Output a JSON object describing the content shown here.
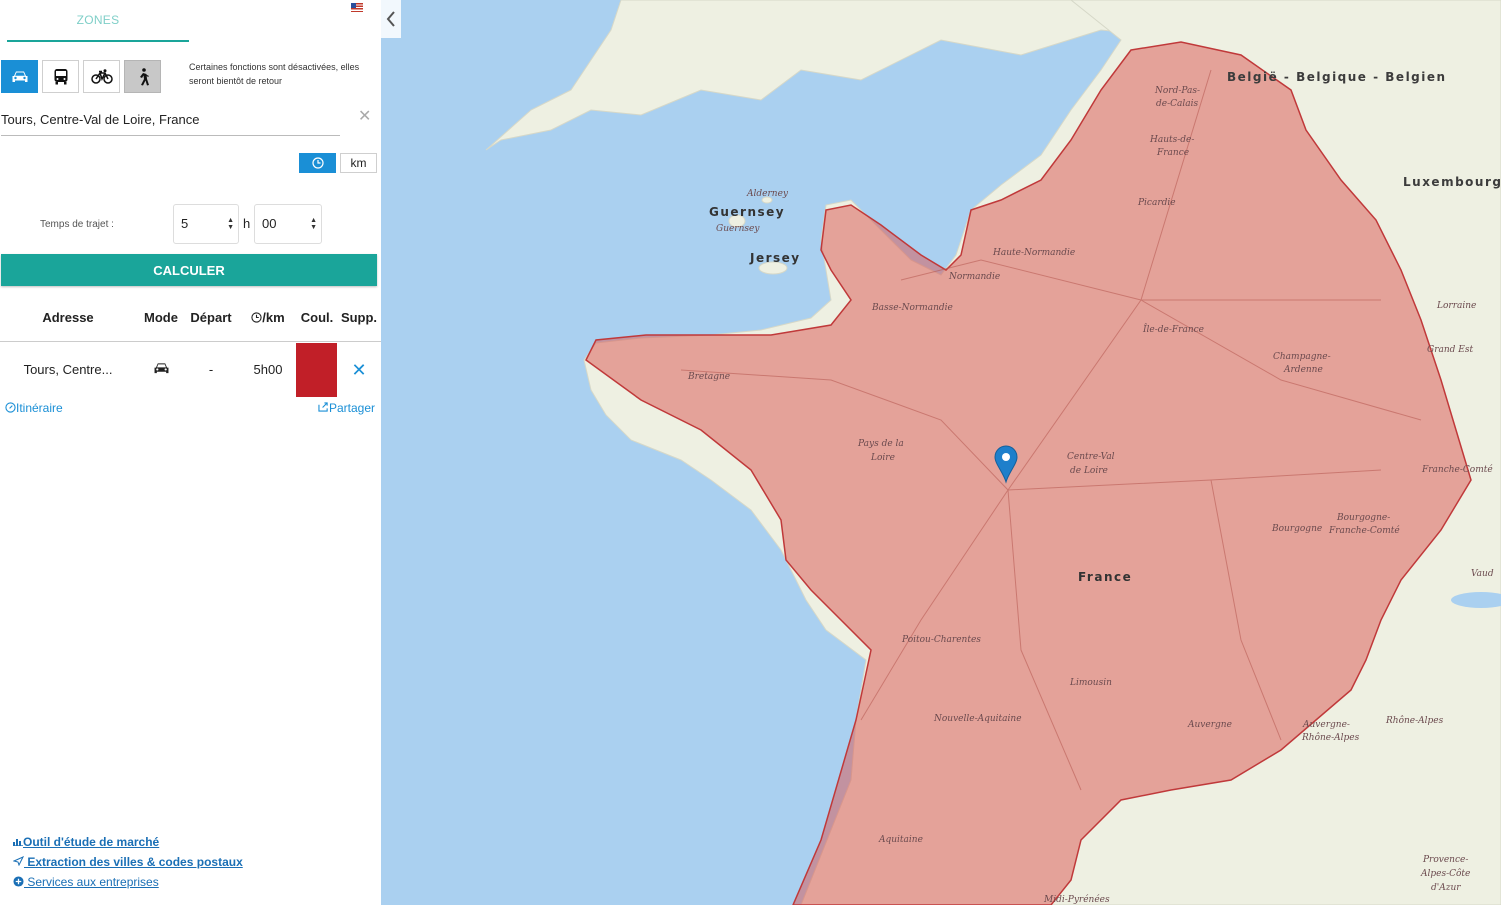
{
  "panel": {
    "tab_label": "ZONES",
    "language_flag": "flag-us",
    "mode_note": "Certaines fonctions sont désactivées, elles seront bientôt de retour",
    "modes": [
      "car-icon",
      "bus-icon",
      "bike-icon",
      "walk-icon"
    ],
    "address_value": "Tours, Centre-Val de Loire, France",
    "unit_km_label": "km",
    "time_label": "Temps de trajet :",
    "hours_value": "5",
    "hours_unit": "h",
    "minutes_value": "00",
    "calc_label": "CALCULER",
    "table": {
      "headers": {
        "address": "Adresse",
        "mode": "Mode",
        "departure": "Départ",
        "timekm": "/km",
        "color": "Coul.",
        "delete": "Supp."
      },
      "row": {
        "address": "Tours, Centre...",
        "mode": "car-icon",
        "departure": "-",
        "time": "5h00",
        "color": "#c11f28",
        "delete": "✕"
      }
    },
    "itinerary_label": "Itinéraire",
    "share_label": "Partager",
    "footer": {
      "market_study": "Outil d'étude de marché",
      "extraction": " Extraction des villes & codes postaux",
      "services": " Services aux entreprises"
    }
  },
  "map": {
    "zone_fill": "#d9534f",
    "labels": {
      "belgium": "België - Belgique - Belgien",
      "luxembourg": "Luxembourg",
      "guernsey": "Guernsey",
      "guernsey_small": "Guernsey",
      "alderney": "Alderney",
      "jersey": "Jersey",
      "france": "France",
      "npdc1": "Nord-Pas-",
      "npdc2": "de-Calais",
      "hdf1": "Hauts-de-",
      "hdf2": "France",
      "picardie": "Picardie",
      "haute_normandie": "Haute-Normandie",
      "normandie": "Normandie",
      "basse_normandie": "Basse-Normandie",
      "idf": "Île-de-France",
      "champagne1": "Champagne-",
      "champagne2": "Ardenne",
      "lorraine": "Lorraine",
      "grand_est": "Grand Est",
      "bretagne": "Bretagne",
      "pdl1": "Pays de la",
      "pdl2": "Loire",
      "cvl1": "Centre-Val",
      "cvl2": "de Loire",
      "franche_comte": "Franche-Comté",
      "bourgogne": "Bourgogne",
      "bfc1": "Bourgogne-",
      "bfc2": "Franche-Comté",
      "vaud": "Vaud",
      "poitou": "Poitou-Charentes",
      "limousin": "Limousin",
      "nouvelle_aquitaine": "Nouvelle-Aquitaine",
      "auvergne": "Auvergne",
      "ara1": "Auvergne-",
      "ara2": "Rhône-Alpes",
      "rhone_alpes": "Rhône-Alpes",
      "aquitaine": "Aquitaine",
      "midi_pyrenees": "Midi-Pyrénées",
      "paca1": "Provence-",
      "paca2": "Alpes-Côte",
      "paca3": "d'Azur"
    }
  }
}
